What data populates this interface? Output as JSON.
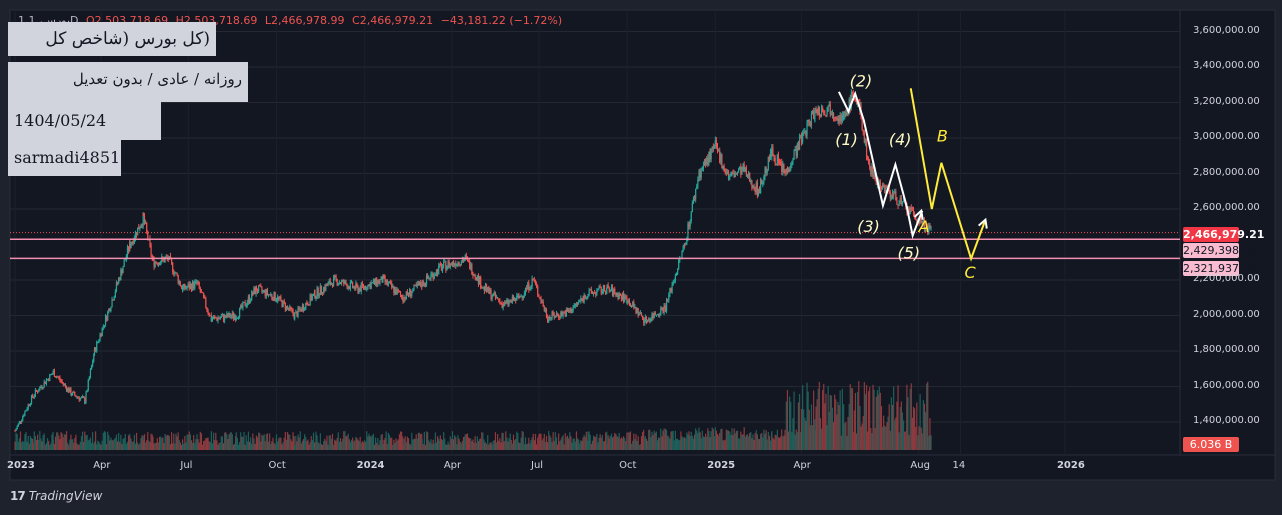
{
  "legend": {
    "symbol": "1 بورس، 1D",
    "open": "O2,503,718.69",
    "high": "H2,503,718.69",
    "low": "L2,466,978.99",
    "close": "C2,466,979.21",
    "change": "−43,181.22 (−1.72%)"
  },
  "info_boxes": {
    "title": "(کل بورس (شاخص کل بورس",
    "subtitle": "روزانه / عادی / بدون تعدیل",
    "datetime": "1404/05/24 21:30",
    "author": "sarmadi4851"
  },
  "price_tags": {
    "last": "2,466,979.21",
    "line1": "2,429,398.56",
    "line2": "2,321,937.10",
    "volume": "6.036 B"
  },
  "branding": {
    "logo_text": "TradingView"
  },
  "colors": {
    "background": "#1e222d",
    "up": "#26a69a",
    "down": "#ef5350",
    "horizontal_line": "#f48fb1",
    "elliott_main": "#ffffff",
    "elliott_correction": "#ffeb3b"
  },
  "chart_data": {
    "type": "candlestick",
    "title": "(کل بورس (شاخص کل بورس",
    "y_axis_labels": [
      "3,600,000.00",
      "3,400,000.00",
      "3,200,000.00",
      "3,000,000.00",
      "2,800,000.00",
      "2,600,000.00",
      "2,200,000.00",
      "2,000,000.00",
      "1,800,000.00",
      "1,600,000.00",
      "1,400,000.00"
    ],
    "x_axis_labels": [
      "2023",
      "Apr",
      "Jul",
      "Oct",
      "2024",
      "Apr",
      "Jul",
      "Oct",
      "2025",
      "Apr",
      "Aug",
      "14",
      "2026"
    ],
    "ylim": [
      1300000,
      3700000
    ],
    "last_close": 2466979.21,
    "last_volume_billion": 6.036,
    "horizontal_levels": [
      2429398.56,
      2321937.1
    ],
    "price_path": [
      [
        "2023-01-01",
        1350000
      ],
      [
        "2023-01-20",
        1550000
      ],
      [
        "2023-02-10",
        1680000
      ],
      [
        "2023-03-01",
        1560000
      ],
      [
        "2023-03-15",
        1520000
      ],
      [
        "2023-03-25",
        1800000
      ],
      [
        "2023-04-10",
        2050000
      ],
      [
        "2023-05-01",
        2400000
      ],
      [
        "2023-05-15",
        2550000
      ],
      [
        "2023-05-25",
        2300000
      ],
      [
        "2023-06-10",
        2320000
      ],
      [
        "2023-06-25",
        2150000
      ],
      [
        "2023-07-10",
        2180000
      ],
      [
        "2023-07-25",
        1980000
      ],
      [
        "2023-08-20",
        2000000
      ],
      [
        "2023-09-10",
        2150000
      ],
      [
        "2023-10-01",
        2100000
      ],
      [
        "2023-10-20",
        2000000
      ],
      [
        "2023-11-10",
        2120000
      ],
      [
        "2023-12-01",
        2200000
      ],
      [
        "2023-12-25",
        2150000
      ],
      [
        "2024-01-20",
        2200000
      ],
      [
        "2024-02-10",
        2100000
      ],
      [
        "2024-03-01",
        2180000
      ],
      [
        "2024-03-20",
        2270000
      ],
      [
        "2024-04-15",
        2320000
      ],
      [
        "2024-05-05",
        2150000
      ],
      [
        "2024-05-25",
        2060000
      ],
      [
        "2024-06-10",
        2100000
      ],
      [
        "2024-06-25",
        2200000
      ],
      [
        "2024-07-10",
        1990000
      ],
      [
        "2024-08-01",
        2020000
      ],
      [
        "2024-08-20",
        2120000
      ],
      [
        "2024-09-10",
        2150000
      ],
      [
        "2024-10-01",
        2090000
      ],
      [
        "2024-10-20",
        1970000
      ],
      [
        "2024-11-10",
        2050000
      ],
      [
        "2024-11-30",
        2400000
      ],
      [
        "2024-12-15",
        2800000
      ],
      [
        "2025-01-01",
        2950000
      ],
      [
        "2025-01-15",
        2780000
      ],
      [
        "2025-01-30",
        2820000
      ],
      [
        "2025-02-15",
        2700000
      ],
      [
        "2025-03-01",
        2920000
      ],
      [
        "2025-03-15",
        2800000
      ],
      [
        "2025-04-01",
        3000000
      ],
      [
        "2025-04-15",
        3150000
      ],
      [
        "2025-05-01",
        3170000
      ],
      [
        "2025-05-15",
        3100000
      ],
      [
        "2025-05-25",
        3250000
      ],
      [
        "2025-06-01",
        3150000
      ],
      [
        "2025-06-10",
        2850000
      ],
      [
        "2025-06-20",
        2750000
      ],
      [
        "2025-07-05",
        2680000
      ],
      [
        "2025-07-20",
        2600000
      ],
      [
        "2025-08-05",
        2520000
      ],
      [
        "2025-08-15",
        2466979.21
      ]
    ],
    "elliott_wave_labels": [
      "(1)",
      "(2)",
      "(3)",
      "(4)",
      "(5)",
      "A",
      "B",
      "C"
    ],
    "elliott_main_path": [
      [
        "2025-05-10",
        3260000
      ],
      [
        "2025-05-20",
        3150000
      ],
      [
        "2025-05-27",
        3250000
      ],
      [
        "2025-06-05",
        3100000
      ],
      [
        "2025-06-25",
        2620000
      ],
      [
        "2025-07-08",
        2850000
      ],
      [
        "2025-07-20",
        2610000
      ],
      [
        "2025-07-26",
        2450000
      ],
      [
        "2025-08-05",
        2590000
      ]
    ],
    "elliott_arrow_main": [
      [
        "2025-07-26",
        2450000
      ],
      [
        "2025-08-04",
        2590000
      ]
    ],
    "elliott_correction_path": [
      [
        "2025-07-24",
        3280000
      ],
      [
        "2025-08-15",
        2600000
      ],
      [
        "2025-08-25",
        2860000
      ],
      [
        "2025-09-25",
        2320000
      ],
      [
        "2025-10-10",
        2540000
      ]
    ]
  }
}
